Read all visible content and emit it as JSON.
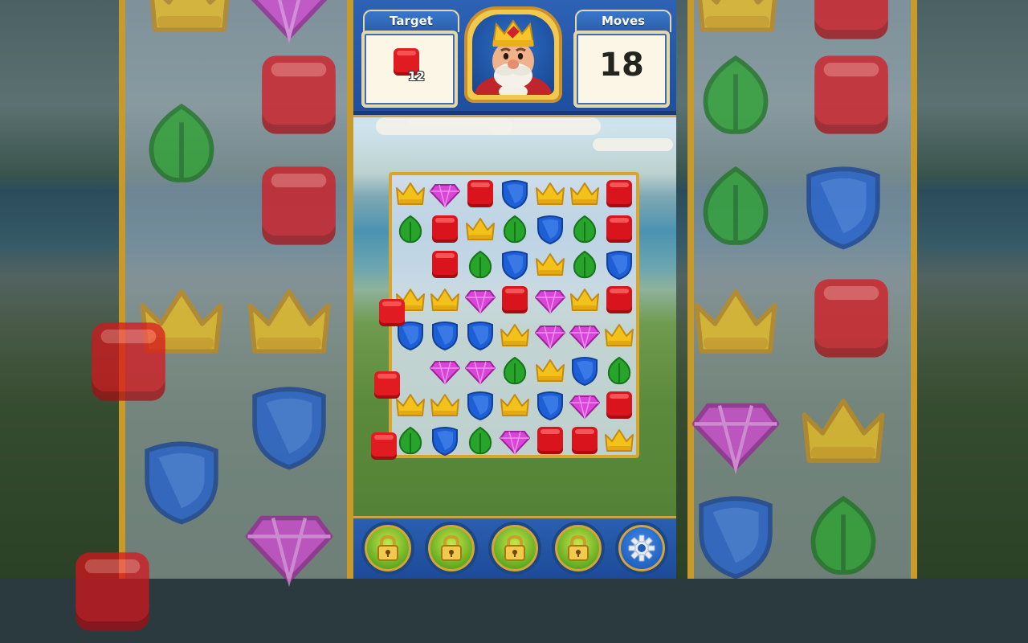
{
  "hud": {
    "target_label": "Target",
    "target_count": "12",
    "moves_label": "Moves",
    "moves_value": "18"
  },
  "board": {
    "rows": [
      [
        "crown",
        "gem",
        "box",
        "shield",
        "crown",
        "crown",
        "box"
      ],
      [
        "leaf",
        "box",
        "crown",
        "leaf",
        "shield",
        "leaf",
        "box"
      ],
      [
        "",
        "box",
        "leaf",
        "shield",
        "crown",
        "leaf",
        "shield"
      ],
      [
        "crown",
        "crown",
        "gem",
        "box",
        "gem",
        "crown",
        "box"
      ],
      [
        "shield",
        "shield",
        "shield",
        "crown",
        "gem",
        "gem",
        "crown"
      ],
      [
        "",
        "gem",
        "gem",
        "leaf",
        "crown",
        "shield",
        "leaf"
      ],
      [
        "crown",
        "crown",
        "shield",
        "crown",
        "shield",
        "gem",
        "box"
      ],
      [
        "leaf",
        "shield",
        "leaf",
        "gem",
        "box",
        "box",
        "crown"
      ]
    ]
  },
  "bottom_buttons": [
    "lock",
    "lock",
    "lock",
    "lock",
    "settings"
  ],
  "colors": {
    "box": "#d9141c",
    "crown": "#f2c21b",
    "shield": "#1d5fd6",
    "leaf": "#27a52a",
    "gem": "#d845d8",
    "frame_gold": "#d9a52a",
    "hud_blue": "#2a5ea8"
  },
  "icons": {
    "target_item": "red-box-icon",
    "portrait": "king-robert-portrait",
    "lock": "padlock-icon",
    "settings": "gear-icon"
  }
}
